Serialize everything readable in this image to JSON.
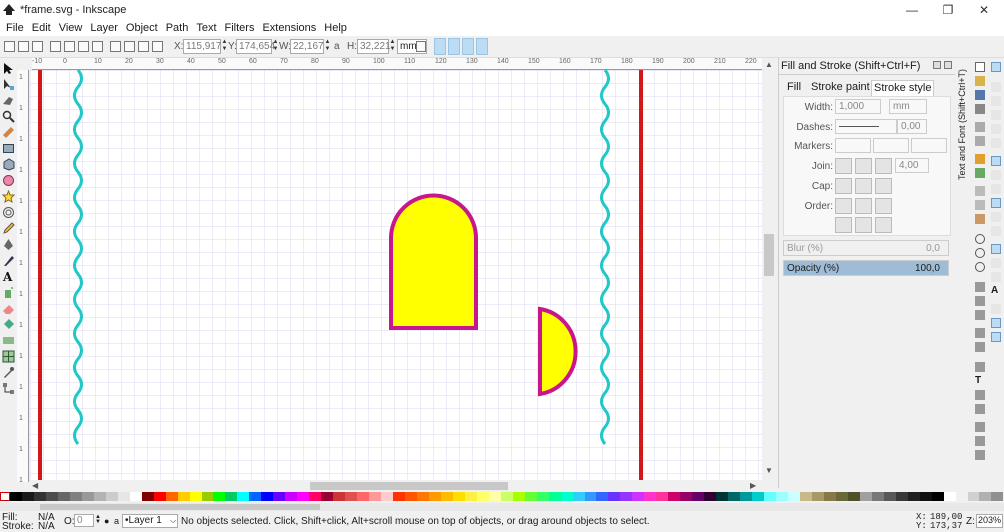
{
  "window": {
    "title": "*frame.svg - Inkscape",
    "minimize_glyph": "—",
    "maximize_glyph": "❐",
    "close_glyph": "✕"
  },
  "menu": [
    "File",
    "Edit",
    "View",
    "Layer",
    "Object",
    "Path",
    "Text",
    "Filters",
    "Extensions",
    "Help"
  ],
  "toolbar": {
    "x_label": "X:",
    "x_value": "115,917",
    "y_label": "Y:",
    "y_value": "174,654",
    "w_label": "W:",
    "w_value": "22,167",
    "lock_glyph": "a",
    "h_label": "H:",
    "h_value": "32,221",
    "unit": "mm"
  },
  "rulers": {
    "h": [
      "-10",
      "0",
      "10",
      "20",
      "30",
      "40",
      "50",
      "60",
      "70",
      "80",
      "90",
      "100",
      "110",
      "120",
      "130",
      "140",
      "150",
      "160",
      "170",
      "180",
      "190",
      "200",
      "210",
      "220"
    ],
    "v": [
      "1",
      "1",
      "1",
      "1",
      "1",
      "1",
      "1",
      "1",
      "1",
      "1",
      "1",
      "1",
      "1",
      "1"
    ]
  },
  "dialog": {
    "title": "Fill and Stroke (Shift+Ctrl+F)",
    "tabs": [
      "Fill",
      "Stroke paint",
      "Stroke style"
    ],
    "width_label": "Width:",
    "width_value": "1,000",
    "width_unit": "mm",
    "dashes_label": "Dashes:",
    "dashes_value": "0,00",
    "markers_label": "Markers:",
    "join_label": "Join:",
    "join_value": "4,00",
    "cap_label": "Cap:",
    "order_label": "Order:",
    "blur_label": "Blur (%)",
    "blur_value": "0,0",
    "opacity_label": "Opacity (%)",
    "opacity_value": "100,0",
    "opacity_fraction": 1.0
  },
  "side_panel_text": "Text and Font (Shift+Ctrl+T)",
  "colors": {
    "canvas_border_red": "#d21818",
    "wave": "#22c7c7",
    "shape_fill": "#ffff00",
    "shape_stroke": "#c8168c",
    "grid": "#d8d8f0"
  },
  "palette": [
    "#000000",
    "#1a1a1a",
    "#333333",
    "#4d4d4d",
    "#666666",
    "#808080",
    "#999999",
    "#b3b3b3",
    "#cccccc",
    "#e6e6e6",
    "#ffffff",
    "#800000",
    "#ff0000",
    "#ff6600",
    "#ffcc00",
    "#ffff00",
    "#99cc00",
    "#00ff00",
    "#00cc66",
    "#00ffff",
    "#0066ff",
    "#0000ff",
    "#6600ff",
    "#cc00ff",
    "#ff00ff",
    "#ff0066",
    "#990033",
    "#cc3333",
    "#e05050",
    "#ff6666",
    "#ff9999",
    "#ffcccc",
    "#ff3300",
    "#ff5500",
    "#ff7700",
    "#ff9900",
    "#ffbb00",
    "#ffdd00",
    "#ffee44",
    "#ffff66",
    "#ffffaa",
    "#ccff66",
    "#aaff00",
    "#66ff33",
    "#33ff66",
    "#00ff99",
    "#00ffcc",
    "#33ccff",
    "#3399ff",
    "#3366ff",
    "#6633ff",
    "#9933ff",
    "#cc33ff",
    "#ff33cc",
    "#ff3399",
    "#cc0066",
    "#990066",
    "#660066",
    "#330033",
    "#003333",
    "#006666",
    "#009999",
    "#00cccc",
    "#66ffff",
    "#99ffff",
    "#ccffff",
    "#c8b88a",
    "#a89868",
    "#887848",
    "#686838",
    "#505028",
    "#a0a0a0",
    "#787878",
    "#585858",
    "#383838",
    "#202020",
    "#101010",
    "#000000",
    "#ffffff",
    "#f0f0f0",
    "#d0d0d0",
    "#b0b0b0",
    "#909090"
  ],
  "status": {
    "fill_label": "Fill:",
    "fill_value": "N/A",
    "stroke_label": "Stroke:",
    "stroke_value": "N/A",
    "opacity_label": "O:",
    "opacity_value": "0",
    "layer_prefix": "•",
    "layer_name": "Layer 1",
    "message": "No objects selected. Click, Shift+click, Alt+scroll mouse on top of objects, or drag around objects to select.",
    "x_label": "X:",
    "x_value": "189,00",
    "y_label": "Y:",
    "y_value": "173,37",
    "zoom_label": "Z:",
    "zoom_value": "203%"
  }
}
